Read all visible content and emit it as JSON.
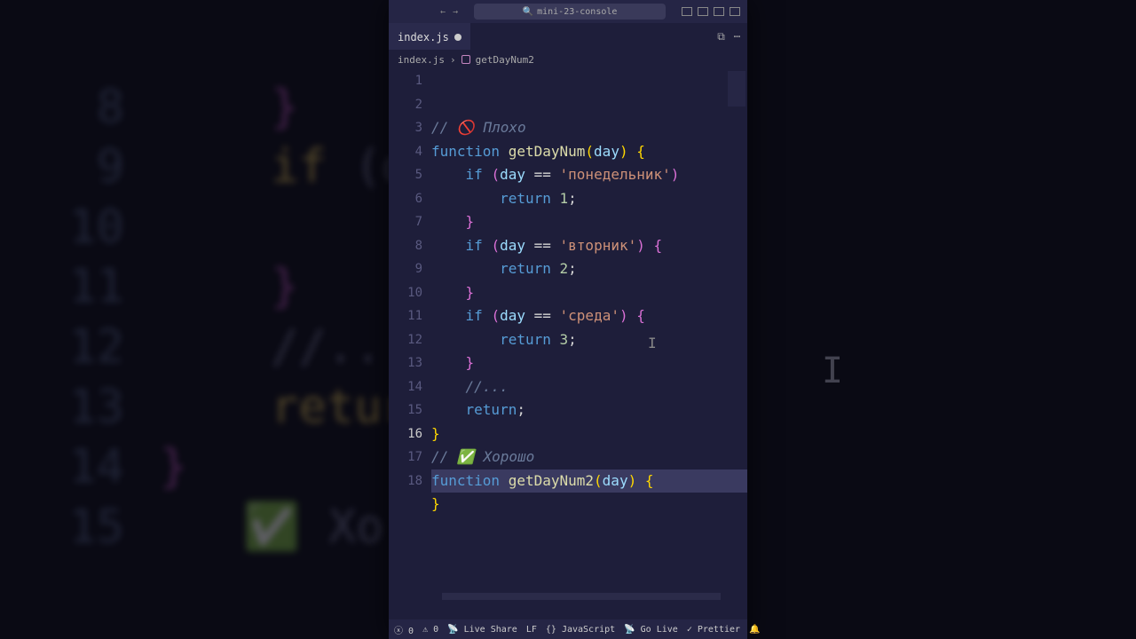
{
  "titlebar": {
    "project": "mini-23-console"
  },
  "tab": {
    "name": "index.js"
  },
  "breadcrumbs": {
    "file": "index.js",
    "symbol": "getDayNum2"
  },
  "code": {
    "lines": [
      {
        "n": "1",
        "html": "<span class='tok-comment'>// 🚫 Плохо</span>"
      },
      {
        "n": "2",
        "html": "<span class='tok-keyword'>function</span> <span class='tok-fn'>getDayNum</span><span class='tok-paren1'>(</span><span class='tok-param'>day</span><span class='tok-paren1'>)</span> <span class='tok-paren1'>{</span>"
      },
      {
        "n": "3",
        "html": "    <span class='tok-keyword'>if</span> <span class='tok-paren2'>(</span><span class='tok-param'>day</span> <span class='tok-punct'>==</span> <span class='tok-string'>'понедельник'</span><span class='tok-paren2'>)</span>"
      },
      {
        "n": "4",
        "html": "        <span class='tok-keyword'>return</span> <span class='tok-num'>1</span><span class='tok-punct'>;</span>"
      },
      {
        "n": "5",
        "html": "    <span class='tok-paren2'>}</span>"
      },
      {
        "n": "6",
        "html": "    <span class='tok-keyword'>if</span> <span class='tok-paren2'>(</span><span class='tok-param'>day</span> <span class='tok-punct'>==</span> <span class='tok-string'>'вторник'</span><span class='tok-paren2'>)</span> <span class='tok-paren2'>{</span>"
      },
      {
        "n": "7",
        "html": "        <span class='tok-keyword'>return</span> <span class='tok-num'>2</span><span class='tok-punct'>;</span>"
      },
      {
        "n": "8",
        "html": "    <span class='tok-paren2'>}</span>"
      },
      {
        "n": "9",
        "html": "    <span class='tok-keyword'>if</span> <span class='tok-paren2'>(</span><span class='tok-param'>day</span> <span class='tok-punct'>==</span> <span class='tok-string'>'среда'</span><span class='tok-paren2'>)</span> <span class='tok-paren2'>{</span>"
      },
      {
        "n": "10",
        "html": "        <span class='tok-keyword'>return</span> <span class='tok-num'>3</span><span class='tok-punct'>;</span>"
      },
      {
        "n": "11",
        "html": "    <span class='tok-paren2'>}</span>"
      },
      {
        "n": "12",
        "html": "    <span class='tok-comment'>//...</span>"
      },
      {
        "n": "13",
        "html": "    <span class='tok-keyword'>return</span><span class='tok-punct'>;</span>"
      },
      {
        "n": "14",
        "html": "<span class='tok-paren1'>}</span>"
      },
      {
        "n": "15",
        "html": "<span class='tok-comment'>// ✅ Хорошо</span>"
      },
      {
        "n": "16",
        "html": "<span class='tok-keyword'>function</span> <span class='tok-fn'>getDayNum2</span><span class='tok-paren1'>(</span><span class='tok-param'>day</span><span class='tok-paren1'>)</span> <span class='tok-paren1'>{</span>",
        "selected": true,
        "active": true
      },
      {
        "n": "17",
        "html": "<span class='tok-paren1'>}</span>"
      },
      {
        "n": "18",
        "html": ""
      }
    ]
  },
  "statusbar": {
    "errors": "0",
    "warnings": "0",
    "liveshare": "Live Share",
    "lf": "LF",
    "lang": "JavaScript",
    "golive": "Go Live",
    "prettier": "Prettier"
  }
}
